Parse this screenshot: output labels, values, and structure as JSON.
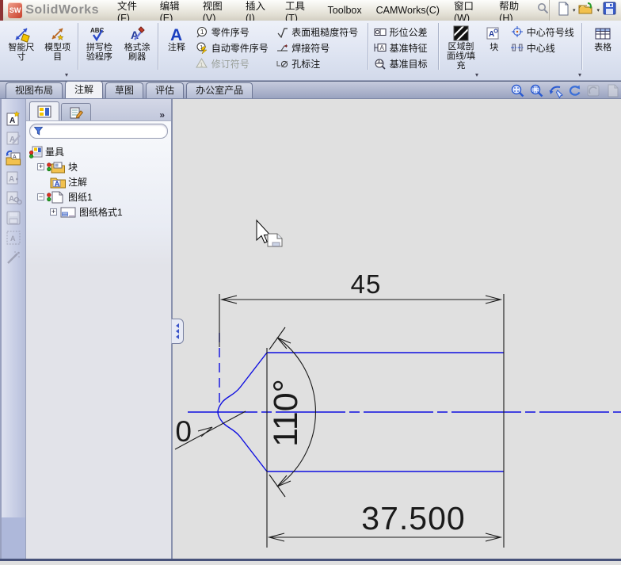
{
  "title_bar": {
    "app_name": "SolidWorks",
    "menu_items": [
      "文件(F)",
      "编辑(E)",
      "视图(V)",
      "插入(I)",
      "工具(T)",
      "Toolbox",
      "CAMWorks(C)",
      "窗口(W)",
      "帮助(H)"
    ]
  },
  "quick_toolbar_icons": [
    "new-document",
    "open-document",
    "save"
  ],
  "ribbon": {
    "smart_dimension": "智能尺\n寸",
    "model_items": "模型项\n目",
    "spell_checker": "拼写检\n验程序",
    "format_painter": "格式涂\n刷器",
    "note": "注释",
    "balloon": "零件序号",
    "auto_balloon": "自动零件序号",
    "revision_symbol": "修订符号",
    "surface_finish": "表面粗糙度符号",
    "weld_symbol": "焊接符号",
    "hole_callout": "孔标注",
    "geometric_tolerance": "形位公差",
    "datum_feature": "基准特征",
    "datum_target": "基准目标",
    "area_hatch": "区域剖\n面线/填\n充",
    "block": "块",
    "center_mark": "中心符号线",
    "centerline": "中心线",
    "tables": "表格"
  },
  "tab_bar": {
    "view_layout": "视图布局",
    "annotation": "注解",
    "sketch": "草图",
    "evaluate": "评估",
    "office_products": "办公室产品"
  },
  "heads_up_icons": [
    "zoom-to-fit",
    "zoom-to-area",
    "previous-view",
    "rebuild",
    "section-view",
    "sheet-properties"
  ],
  "left_toolbar_icons": [
    "note-star",
    "note-pencil",
    "folder-arrow",
    "note-plus",
    "note-link",
    "save-disk",
    "stamp-pattern",
    "wand"
  ],
  "feature_tree": {
    "root": "量具",
    "block_folder": "块",
    "annotations": "注解",
    "sheet": "图纸1",
    "sheet_format": "图纸格式1"
  },
  "drawing": {
    "dim_length": "45",
    "dim_angle": "110°",
    "dim_tip": "37.500",
    "dim_partial": "0",
    "line_color": "#0d0de0",
    "dim_color": "#1a1a1a"
  },
  "glyphs": {
    "dropdown": "▾",
    "chevron": "»",
    "expand": "+",
    "collapse": "−"
  }
}
